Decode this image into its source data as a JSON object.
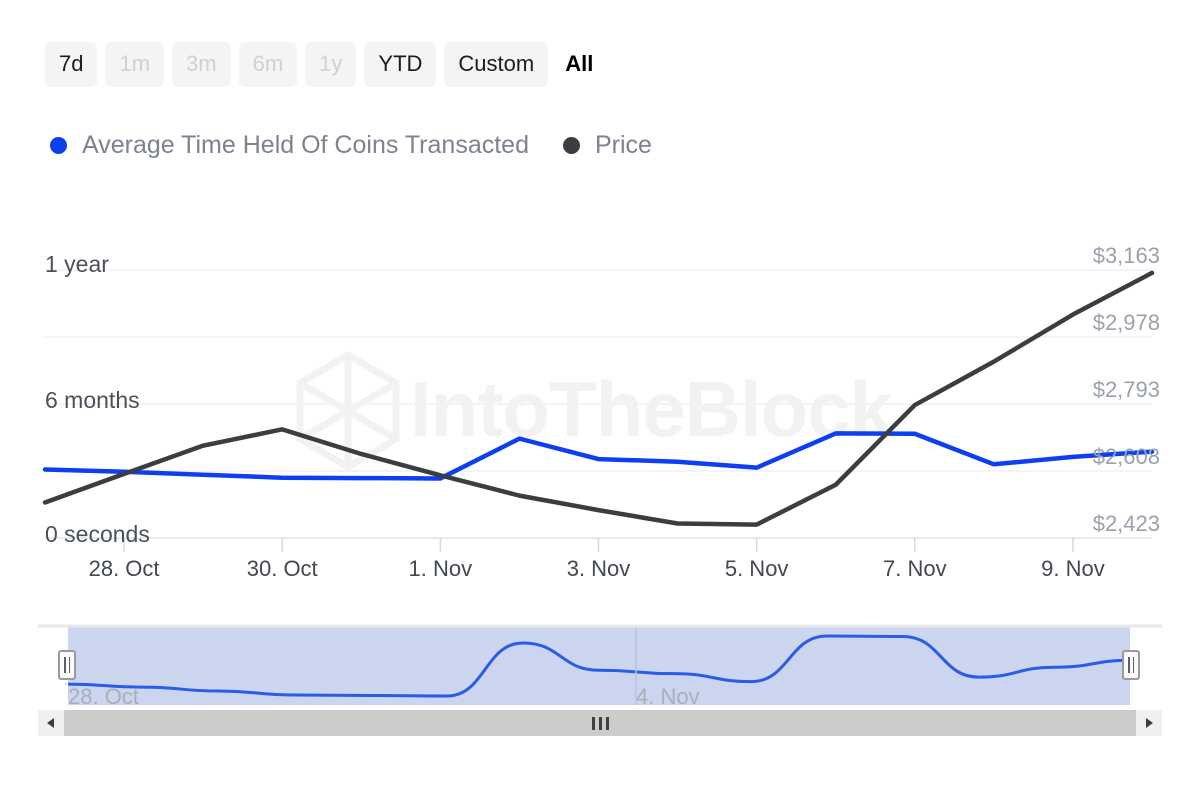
{
  "range_selector": {
    "buttons": [
      {
        "label": "7d",
        "state": "normal"
      },
      {
        "label": "1m",
        "state": "disabled"
      },
      {
        "label": "3m",
        "state": "disabled"
      },
      {
        "label": "6m",
        "state": "disabled"
      },
      {
        "label": "1y",
        "state": "disabled"
      },
      {
        "label": "YTD",
        "state": "normal"
      },
      {
        "label": "Custom",
        "state": "normal"
      },
      {
        "label": "All",
        "state": "active"
      }
    ]
  },
  "legend": {
    "items": [
      {
        "label": "Average Time Held Of Coins Transacted",
        "color": "#0d3ef0"
      },
      {
        "label": "Price",
        "color": "#3a3d42"
      }
    ]
  },
  "watermark": {
    "text": "IntoTheBlock"
  },
  "navigator": {
    "start_label": "28. Oct",
    "mid_label": "4. Nov",
    "series_color": "#2a5ce8",
    "fill_color": "#ccd6ef",
    "selection_color": "#ccd6ef"
  },
  "scrollbar": {
    "left_arrow": "left-arrow-icon",
    "right_arrow": "right-arrow-icon",
    "grip": "drag-grip-icon"
  },
  "chart_data": {
    "type": "line",
    "title": "",
    "xlabel": "",
    "grid": true,
    "legend_position": "top-left",
    "x_tick_labels": [
      "28. Oct",
      "30. Oct",
      "1. Nov",
      "3. Nov",
      "5. Nov",
      "7. Nov",
      "9. Nov"
    ],
    "x_dates": [
      "27. Oct",
      "28. Oct",
      "29. Oct",
      "30. Oct",
      "31. Oct",
      "1. Nov",
      "2. Nov",
      "3. Nov",
      "4. Nov",
      "5. Nov",
      "6. Nov",
      "7. Nov",
      "8. Nov",
      "9. Nov",
      "10. Nov"
    ],
    "axes": {
      "left": {
        "label": "Average Time Held Of Coins Transacted",
        "tick_labels": [
          "1 year",
          "6 months",
          "0 seconds"
        ],
        "tick_values": [
          31536000,
          15768000,
          0
        ],
        "ylim": [
          0,
          36000000
        ]
      },
      "right": {
        "label": "Price",
        "tick_labels": [
          "$3,163",
          "$2,978",
          "$2,793",
          "$2,608",
          "$2,423"
        ],
        "tick_values": [
          3163,
          2978,
          2793,
          2608,
          2423
        ],
        "ylim": [
          2423,
          3163
        ]
      }
    },
    "series": [
      {
        "name": "Average Time Held Of Coins Transacted",
        "axis": "left",
        "color": "#0d3ef0",
        "unit": "seconds",
        "values": [
          9200000,
          8900000,
          8500000,
          8100000,
          8050000,
          8000000,
          13350000,
          10600000,
          10250000,
          9450000,
          14050000,
          14000000,
          9900000,
          10900000,
          11600000
        ]
      },
      {
        "name": "Price",
        "axis": "right",
        "color": "#3a3d42",
        "unit": "USD",
        "values": [
          2521,
          2600,
          2678,
          2723,
          2655,
          2596,
          2540,
          2500,
          2463,
          2460,
          2570,
          2790,
          2910,
          3040,
          3155
        ]
      }
    ]
  }
}
